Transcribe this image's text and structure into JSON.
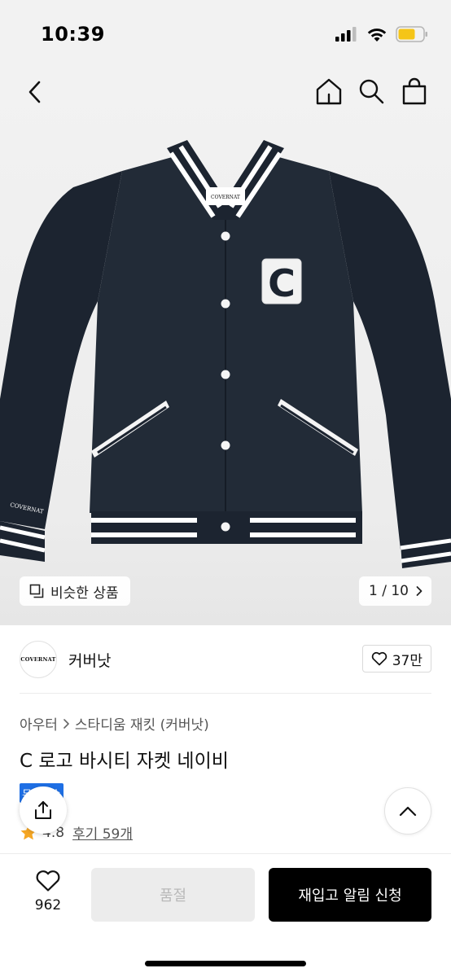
{
  "status_bar": {
    "time": "10:39"
  },
  "nav": {
    "icons": [
      "back-arrow-icon",
      "home-icon",
      "search-icon",
      "shopping-bag-icon"
    ]
  },
  "gallery": {
    "similar_label": "비슷한 상품",
    "page_indicator": "1 / 10",
    "patch_letter": "C",
    "tag_text": "COVERNAT",
    "sleeve_text": "COVERNAT"
  },
  "brand": {
    "logo_text": "COVERNAT",
    "name": "커버낫",
    "like_count": "37만"
  },
  "product": {
    "breadcrumb": [
      "아우터",
      "스타디움 재킷 (커버낫)"
    ],
    "title": "C 로고 바시티 자켓 네이비",
    "badge": "무료배송",
    "rating": "4.8",
    "review_link": "후기 59개"
  },
  "bottom": {
    "wish_count": "962",
    "soldout_label": "품절",
    "restock_label": "재입고 알림 신청"
  },
  "colors": {
    "accent": "#1e6fe5",
    "jacket": "#1c2430",
    "primary_button": "#000000"
  }
}
